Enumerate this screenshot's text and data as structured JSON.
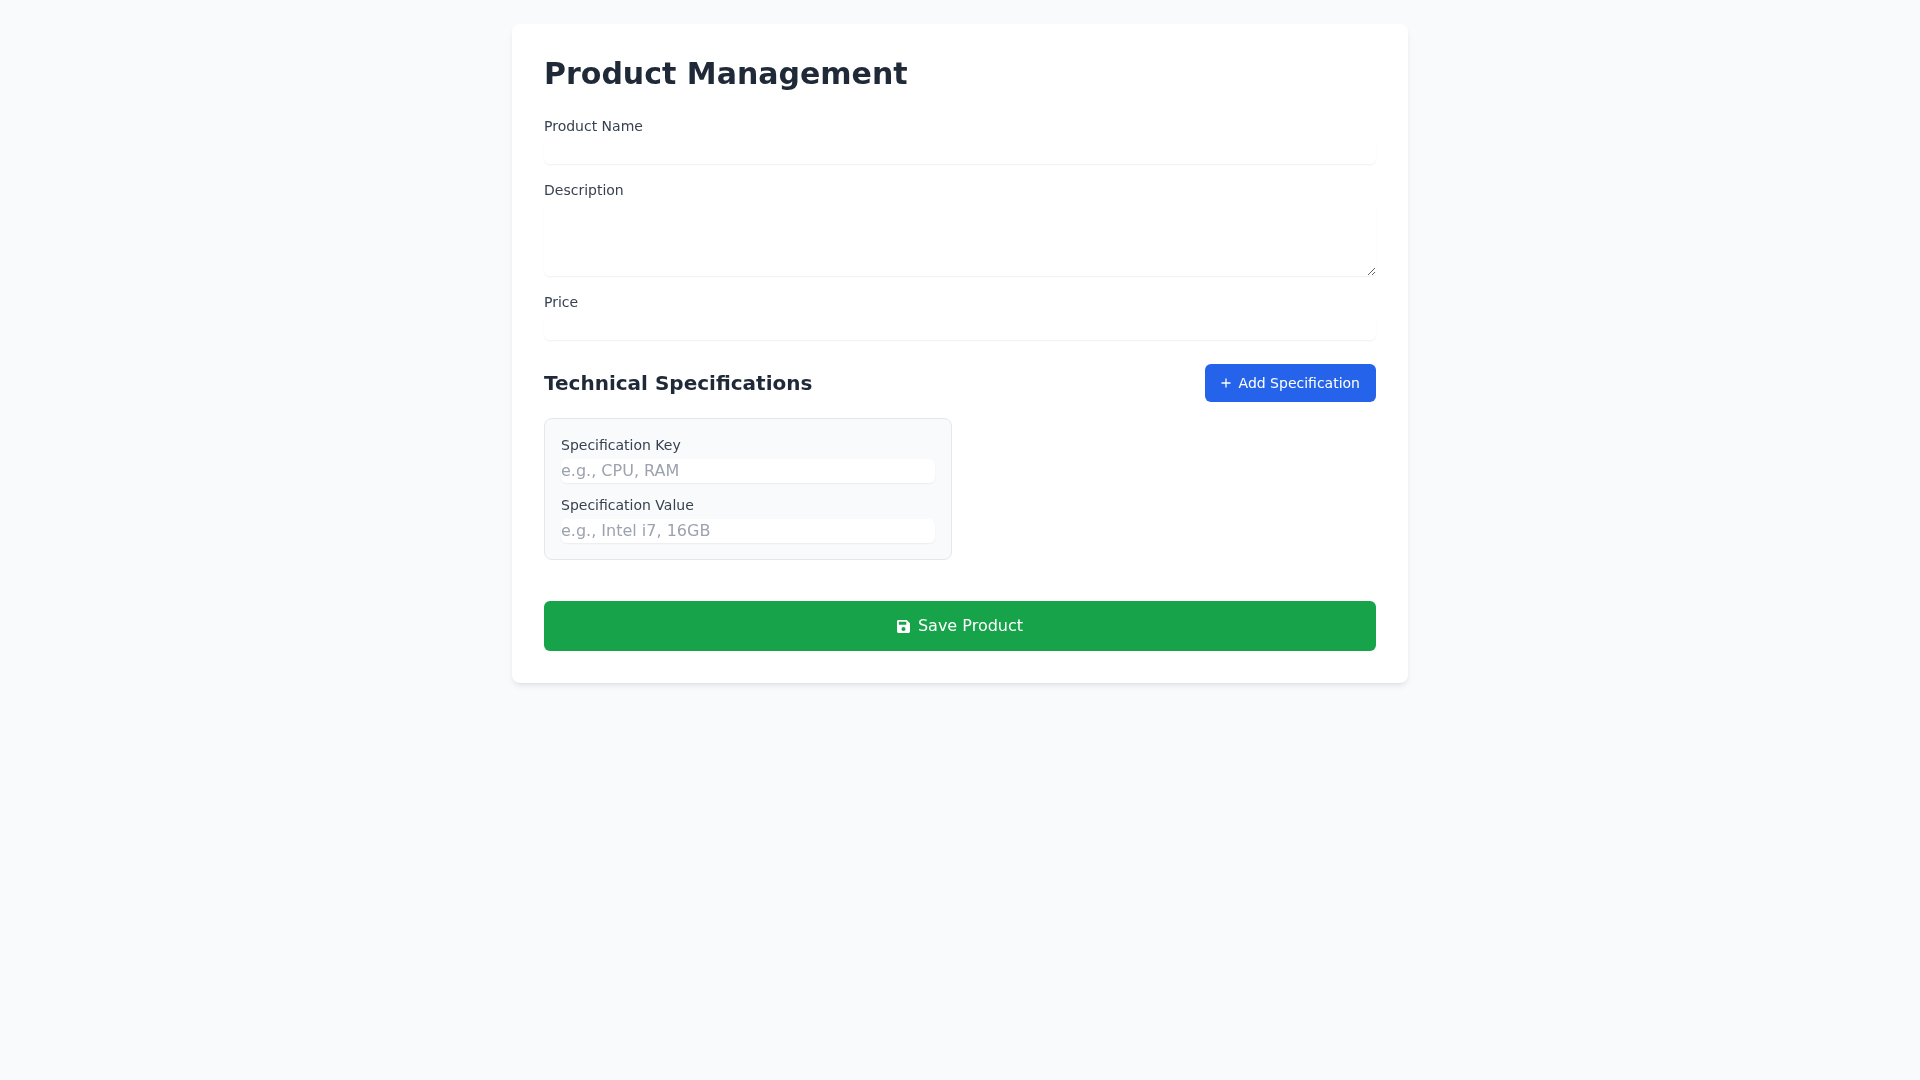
{
  "title": "Product Management",
  "fields": [
    {
      "label": "Product Name",
      "kind": "input"
    },
    {
      "label": "Description",
      "kind": "textarea"
    },
    {
      "label": "Price",
      "kind": "input"
    }
  ],
  "specifications": {
    "heading": "Technical Specifications",
    "add_button": "Add Specification",
    "items": [
      {
        "key": {
          "label": "Specification Key",
          "placeholder": "e.g., CPU, RAM"
        },
        "value": {
          "label": "Specification Value",
          "placeholder": "e.g., Intel i7, 16GB"
        }
      }
    ]
  },
  "save_button": "Save Product"
}
